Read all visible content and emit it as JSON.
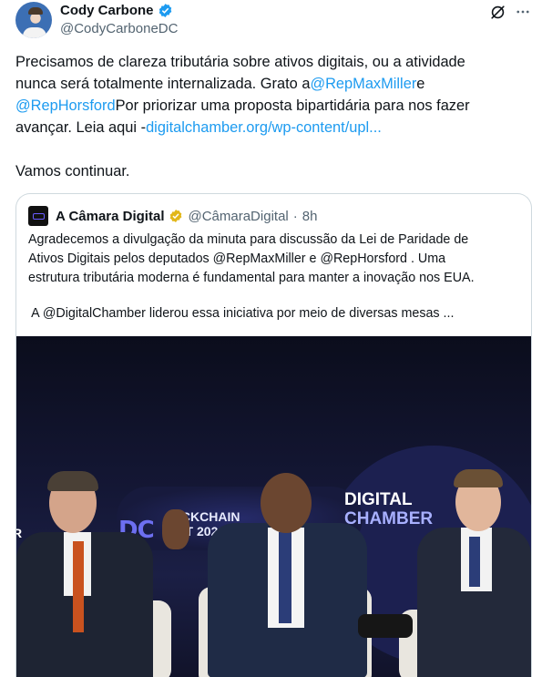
{
  "author": {
    "display_name": "Cody Carbone",
    "handle": "@CodyCarboneDC"
  },
  "tweet": {
    "line1": "Precisamos de clareza tributária sobre ativos digitais, ou a atividade",
    "line2_a": "nunca será totalmente internalizada. Grato a",
    "mention_miller": "@RepMaxMiller",
    "line2_b": "e",
    "mention_horsford": "@RepHorsford",
    "line3_b": "Por priorizar uma proposta bipartidária para nos fazer",
    "line4_a": "avançar. Leia aqui -",
    "link": "digitalchamber.org/wp-content/upl...",
    "line5": "Vamos continuar."
  },
  "quote": {
    "display_name": "A Câmara Digital",
    "handle": "@CâmaraDigital",
    "dot": "·",
    "time": "8h",
    "para1_l1": "Agradecemos a divulgação da minuta para discussão da Lei de Paridade de",
    "para1_l2": "Ativos Digitais pelos deputados @RepMaxMiller e @RepHorsford . Uma",
    "para1_l3": "estrutura tributária moderna é fundamental para manter a inovação nos EUA.",
    "para2": " A @DigitalChamber liderou essa iniciativa por meio de diversas mesas ..."
  },
  "photo": {
    "signs": {
      "dc": "DC",
      "summit_l1": "OCKCHAIN",
      "summit_l2": "MIT 2026",
      "chamber_l1": "DIGITAL",
      "chamber_l2": "CHAMBER",
      "edge": "R"
    }
  },
  "icons": {
    "verified": "verified-badge-icon",
    "grok": "grok-icon",
    "more": "more-icon",
    "quote_verified": "gold-verified-badge-icon"
  },
  "colors": {
    "link": "#1d9bf0",
    "verified_blue": "#1d9bf0",
    "verified_gold": "#e2b719",
    "secondary_text": "#536471"
  }
}
